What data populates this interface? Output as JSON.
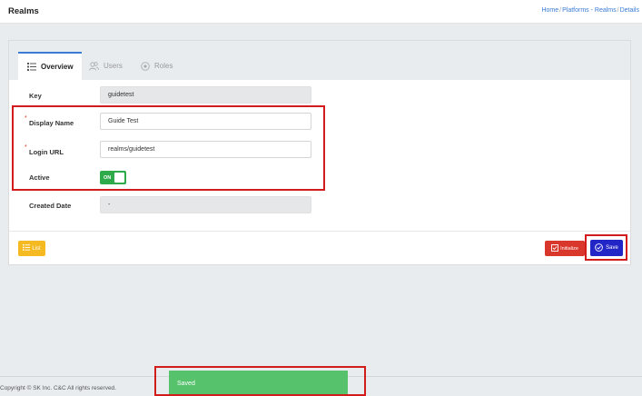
{
  "header": {
    "title": "Realms",
    "breadcrumb": [
      "Home",
      "Platforms - Realms",
      "Details"
    ]
  },
  "tabs": [
    {
      "label": "Overview",
      "icon": "list-icon",
      "active": true
    },
    {
      "label": "Users",
      "icon": "users-icon",
      "active": false
    },
    {
      "label": "Roles",
      "icon": "roles-icon",
      "active": false
    }
  ],
  "form": {
    "key": {
      "label": "Key",
      "value": "guidetest",
      "readonly": true
    },
    "display_name": {
      "label": "Display Name",
      "value": "Guide Test",
      "required": true
    },
    "login_url": {
      "label": "Login URL",
      "value": "realms/guidetest",
      "required": true
    },
    "active": {
      "label": "Active",
      "toggle_text": "ON",
      "value": true
    },
    "created_date": {
      "label": "Created Date",
      "value": "-",
      "readonly": true
    }
  },
  "actions": {
    "list_label": "List",
    "initialize_label": "Initialize",
    "save_label": "Save"
  },
  "footer": {
    "copyright": "Copyright © SK Inc. C&C All rights reserved."
  },
  "toast": {
    "message": "Saved"
  },
  "colors": {
    "accent": "#3a7bd5",
    "toggle_on": "#2faa4a",
    "list_button": "#f5b921",
    "initialize_button": "#d9372b",
    "save_button": "#2326c6",
    "toast": "#57c26c",
    "highlight": "#d21c1c"
  }
}
